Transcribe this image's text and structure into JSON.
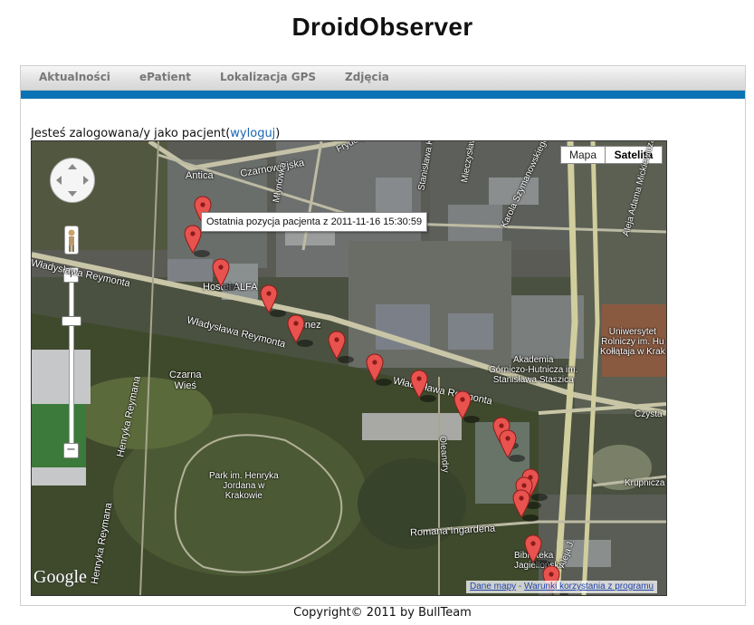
{
  "header": {
    "title": "DroidObserver"
  },
  "nav": {
    "items": [
      {
        "label": "Aktualności"
      },
      {
        "label": "ePatient"
      },
      {
        "label": "Lokalizacja GPS"
      },
      {
        "label": "Zdjęcia"
      }
    ]
  },
  "login": {
    "prefix": "Jesteś zalogowana/y jako pacjent(",
    "link": "wyloguj",
    "suffix": ")"
  },
  "map": {
    "type_buttons": [
      {
        "label": "Mapa"
      },
      {
        "label": "Satelita"
      }
    ],
    "selected_type": "Satelita",
    "info_window": "Ostatnia pozycja pacjenta z 2011-11-16 15:30:59",
    "labels": {
      "czarnowiejska": "Czarnowiejska",
      "antica": "Antica",
      "hostel_alfa": "Hostel ALFA",
      "pionez": "Pionez",
      "reymonta_1": "Władysława Reymonta",
      "reymonta_2": "Władysława Reymonta",
      "reymonta_3": "Władysława Reymonta",
      "czarna_wies": "Czarna\nWieś",
      "park": "Park im. Henryka\nJordana w\nKrakowie",
      "henryka_1": "Henryka Reymana",
      "henryka_2": "Henryka Reymana",
      "oleandry": "Oleandry",
      "romana": "Romana Ingardena",
      "biblioteka": "Biblioteka\nJagiellońska",
      "akademia": "Akademia\nGórniczo-Hutnicza im.\nStanisława Staszica",
      "uniwersytet": "Uniwersytet\nRolniczy im. Hu\nKołłątaja w Krak",
      "czysta": "Czysta",
      "krupnicza": "Krupnicza",
      "fryderyka": "Fryderyka",
      "mlynowka": "Młynówka",
      "stanislawa_konarskiego": "Stanisława Kona",
      "mieczyslawa": "Mieczysława",
      "karola": "Karola Szymanowskiego",
      "aleja": "Aleja Adama Mickiewicza",
      "aleja2": "Aleja J."
    },
    "google_logo": "Google",
    "attribution": [
      "Dane mapy",
      "Warunki korzystania z programu"
    ],
    "markers_count": 16
  },
  "footer": {
    "copyright": "Copyright© 2011 by BullTeam"
  },
  "colors": {
    "nav_bar": "#0a73b5",
    "link": "#1a66b3",
    "marker": "#e8524f"
  }
}
